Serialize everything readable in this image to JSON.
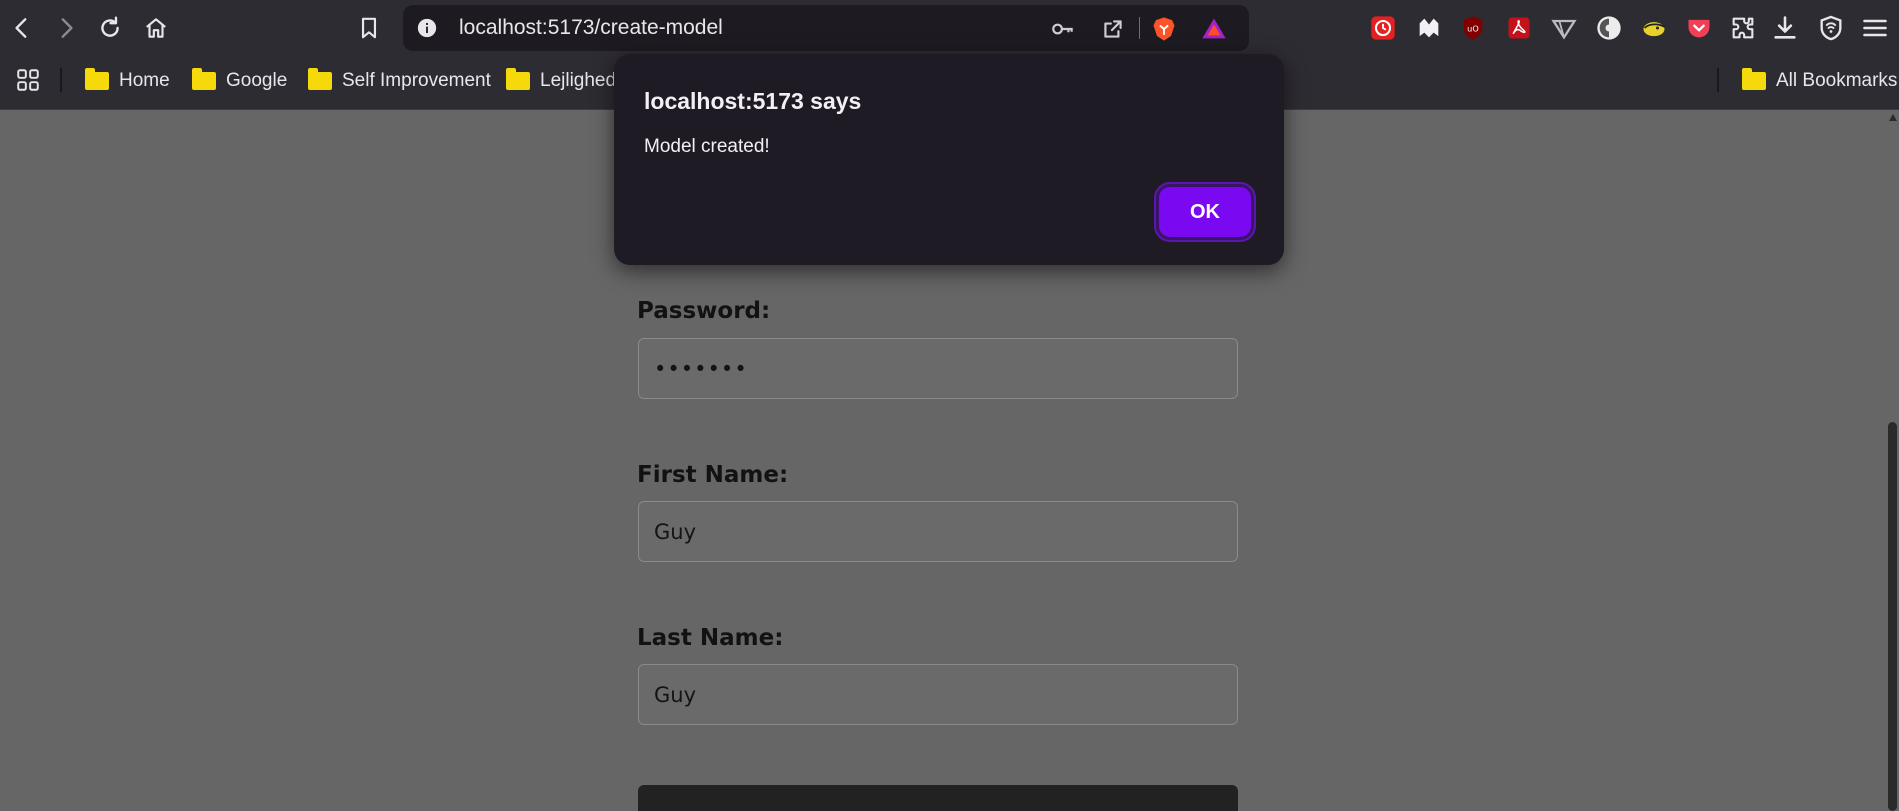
{
  "browser": {
    "url": "localhost:5173/create-model",
    "bookmarks": [
      {
        "label": "Home"
      },
      {
        "label": "Google"
      },
      {
        "label": "Self Improvement"
      },
      {
        "label": "Lejlighed"
      }
    ],
    "all_bookmarks_label": "All Bookmarks",
    "icons": [
      "back-icon",
      "forward-icon",
      "reload-icon",
      "home-icon",
      "bookmark-icon",
      "info-icon",
      "key-icon",
      "share-icon",
      "brave-shield-icon",
      "brave-rewards-icon",
      "extensions-icon",
      "downloads-icon",
      "vpn-icon",
      "menu-icon"
    ]
  },
  "form": {
    "password": {
      "label": "Password:",
      "value": "•••••••"
    },
    "first_name": {
      "label": "First Name:",
      "value": "Guy"
    },
    "last_name": {
      "label": "Last Name:",
      "value": "Guy"
    }
  },
  "dialog": {
    "title": "localhost:5173 says",
    "message": "Model created!",
    "ok_label": "OK"
  },
  "colors": {
    "page_background": "#666666",
    "chrome_background": "#2e2c33",
    "dialog_background": "#1f1b24",
    "ok_button": "#7a08f0",
    "folder": "#f5d90a"
  }
}
